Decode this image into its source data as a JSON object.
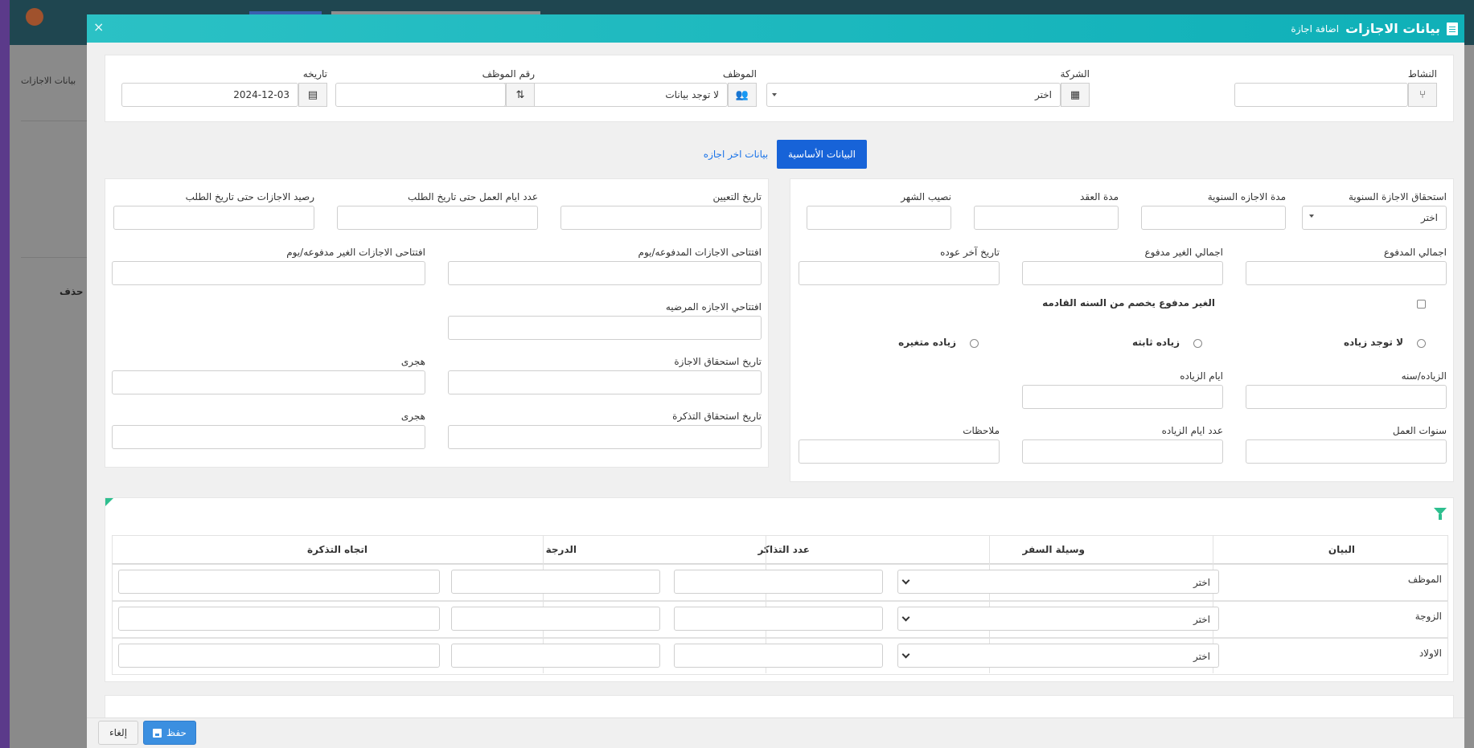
{
  "background": {
    "breadcrumb": "بيانات الاجازات",
    "delete_header": "حذف"
  },
  "modal": {
    "title": "بيانات الاجازات",
    "subtitle": "اضافة اجازة",
    "close": "×"
  },
  "top_fields": {
    "activity_label": "النشاط",
    "company_label": "الشركة",
    "company_value": "اختر",
    "employee_label": "الموظف",
    "employee_value": "لا توجد بيانات",
    "emp_no_label": "رقم الموظف",
    "date_label": "تاريخه",
    "date_value": "2024-12-03"
  },
  "tabs": {
    "basic": "البيانات الأساسية",
    "last_leave": "بيانات اخر اجازه"
  },
  "right_panel": {
    "annual_entitlement_label": "استحقاق الاجازة السنوية",
    "annual_entitlement_value": "اختر",
    "annual_leave_duration_label": "مدة الاجازه السنوية",
    "contract_duration_label": "مدة العقد",
    "month_share_label": "نصيب الشهر",
    "total_paid_label": "اجمالي المدفوع",
    "total_unpaid_label": "اجمالي الغير مدفوع",
    "last_return_date_label": "تاريخ آخر عوده",
    "unpaid_deduct_label": "الغير مدفوع يخصم من السنه القادمه",
    "radio_no_increase": "لا توجد زياده",
    "radio_fixed_increase": "زياده ثابته",
    "radio_variable_increase": "زياده متغيره",
    "increase_per_year_label": "الزياده/سنه",
    "increase_days_label": "ايام الزياده",
    "work_years_label": "سنوات العمل",
    "increase_days_count_label": "عدد ايام الزياده",
    "notes_label": "ملاحظات"
  },
  "left_panel": {
    "hire_date_label": "تاريخ التعيين",
    "work_days_label": "عدد ايام العمل حتى تاريخ الطلب",
    "leave_balance_label": "رصيد الاجازات حتى تاريخ الطلب",
    "opening_paid_label": "افتتاحى الاجازات المدفوعه/يوم",
    "opening_unpaid_label": "افتتاحى الاجازات الغير مدفوعه/يوم",
    "opening_sick_label": "افتتاحي الاجازه المرضيه",
    "leave_due_date_label": "تاريخ استحقاق الاجازة",
    "hijri_1_label": "هجرى",
    "ticket_due_date_label": "تاريخ استحقاق التذكرة",
    "hijri_2_label": "هجرى"
  },
  "tickets_table": {
    "headers": [
      "البيان",
      "وسيلة السفر",
      "عدد التذاكر",
      "الدرجة",
      "اتجاه التذكرة"
    ],
    "rows": [
      {
        "label": "الموظف",
        "travel": "اختر"
      },
      {
        "label": "الزوجة",
        "travel": "اختر"
      },
      {
        "label": "الاولاد",
        "travel": "اختر"
      }
    ]
  },
  "footer": {
    "save": "حفظ",
    "cancel": "إلغاء"
  }
}
